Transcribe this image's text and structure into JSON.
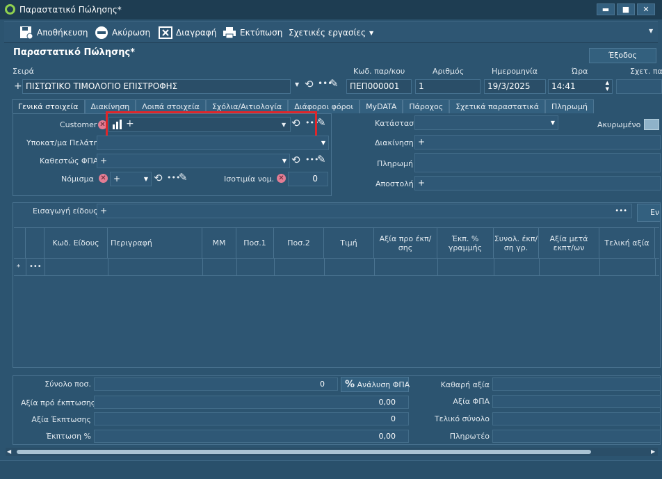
{
  "window": {
    "title": "Παραστατικό Πώλησης*",
    "min": "▬",
    "max": "■",
    "close": "✕"
  },
  "toolbar": {
    "save": "Αποθήκευση",
    "cancel": "Ακύρωση",
    "delete": "Διαγραφή",
    "print": "Εκτύπωση",
    "related": "Σχετικές εργασίες"
  },
  "page_title": "Παραστατικό Πώλησης*",
  "exit": "Έξοδος",
  "header": {
    "series_label": "Σειρά",
    "series_value": "ΠΙΣΤΩΤΙΚΟ ΤΙΜΟΛΟΓΙΟ ΕΠΙΣΤΡΟΦΗΣ",
    "code_label": "Κωδ. παρ/κου",
    "code_value": "ΠΕΠ000001",
    "number_label": "Αριθμός",
    "number_value": "1",
    "date_label": "Ημερομηνία",
    "date_value": "19/3/2025",
    "time_label": "Ώρα",
    "time_value": "14:41",
    "related_label": "Σχετ. πα"
  },
  "tabs": [
    "Γενικά στοιχεία",
    "Διακίνηση",
    "Λοιπά στοιχεία",
    "Σχόλια/Αιτιολογία",
    "Διάφοροι φόροι",
    "MyDATA",
    "Πάροχος",
    "Σχετικά παραστατικά",
    "Πληρωμή"
  ],
  "general": {
    "customer_label": "Customer",
    "subcust_label": "Υποκατ/μα Πελάτη",
    "vat_label": "Καθεστώς ΦΠΑ",
    "currency_label": "Νόμισμα",
    "rate_label": "Ισοτιμία νομ.",
    "rate_value": "0",
    "status_label": "Κατάσταση",
    "cancelled_label": "Ακυρωμένο",
    "transport_label": "Διακίνηση",
    "payment_label": "Πληρωμή",
    "shipment_label": "Αποστολή"
  },
  "items": {
    "add_label": "Εισαγωγή είδους",
    "right_btn": "Εν",
    "columns": [
      "Κωδ. Είδους",
      "Περιγραφή",
      "ΜΜ",
      "Ποσ.1",
      "Ποσ.2",
      "Τιμή",
      "Αξία προ έκπ/σης",
      "Έκπ. % γραμμής",
      "Συνολ. έκπ/ση γρ.",
      "Αξία μετά εκπτ/ων",
      "Τελική αξία"
    ],
    "row_marker": "*",
    "row_more": "•••"
  },
  "totals": {
    "qty_label": "Σύνολο ποσ.",
    "qty_value": "0",
    "vat_analysis": "Ανάλυση ΦΠΑ",
    "before_disc_label": "Αξία πρό έκπτωσης",
    "before_disc_value": "0,00",
    "disc_value_label": "Αξία Έκπτωσης",
    "disc_value": "0",
    "disc_pct_label": "Έκπτωση %",
    "disc_pct_value": "0,00",
    "net_label": "Καθαρή αξία",
    "vat_value_label": "Αξία ΦΠΑ",
    "final_label": "Τελικό σύνολο",
    "payable_label": "Πληρωτέο"
  }
}
